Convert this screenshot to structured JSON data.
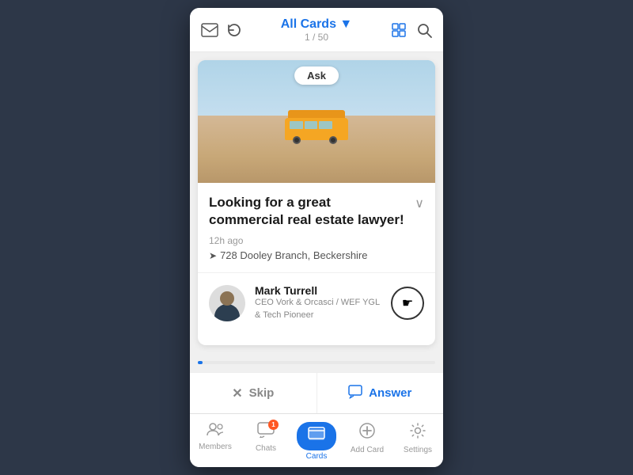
{
  "header": {
    "title": "All Cards ▼",
    "subtitle": "1 / 50",
    "inbox_icon": "✉",
    "refresh_icon": "↺",
    "grid_icon": "⊞",
    "search_icon": "🔍"
  },
  "card": {
    "ask_label": "Ask",
    "title": "Looking for a great commercial real estate lawyer!",
    "time": "12h ago",
    "location": "728 Dooley Branch, Beckershire",
    "profile": {
      "name": "Mark Turrell",
      "title": "CEO Vork & Orcasci / WEF YGL & Tech Pioneer"
    }
  },
  "actions": {
    "skip_label": "Skip",
    "answer_label": "Answer"
  },
  "nav": {
    "items": [
      {
        "label": "Members",
        "icon": "👥",
        "active": false
      },
      {
        "label": "Chats",
        "icon": "💬",
        "active": false,
        "badge": "1"
      },
      {
        "label": "Cards",
        "icon": "🃏",
        "active": true
      },
      {
        "label": "Add Card",
        "icon": "⊕",
        "active": false
      },
      {
        "label": "Settings",
        "icon": "⚙",
        "active": false
      }
    ]
  }
}
